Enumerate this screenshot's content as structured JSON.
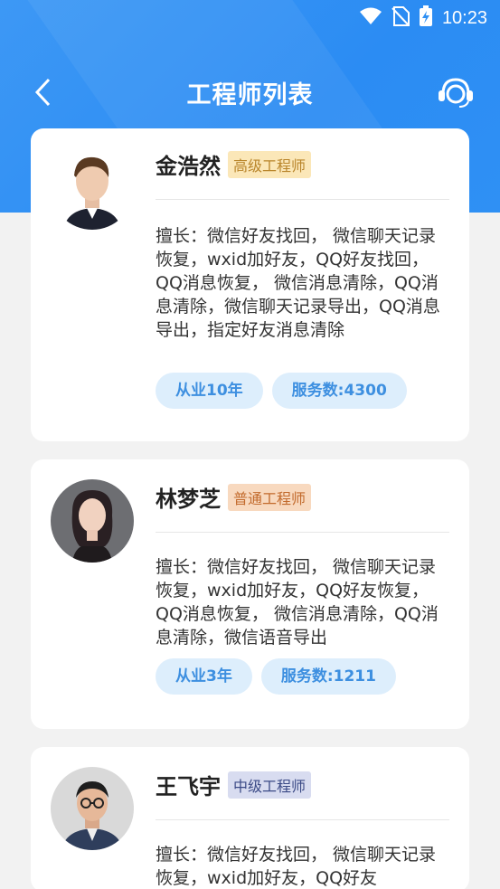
{
  "status": {
    "time": "10:23"
  },
  "header": {
    "title": "工程师列表"
  },
  "engineers": [
    {
      "name": "金浩然",
      "level": "高级工程师",
      "specialty": "擅长：微信好友找回， 微信聊天记录恢复，wxid加好友，QQ好友找回，QQ消息恢复， 微信消息清除，QQ消息清除，微信聊天记录导出，QQ消息导出，指定好友消息清除",
      "years": "从业10年",
      "services": "服务数:4300"
    },
    {
      "name": "林梦芝",
      "level": "普通工程师",
      "specialty": "擅长：微信好友找回， 微信聊天记录恢复，wxid加好友，QQ好友恢复，QQ消息恢复， 微信消息清除，QQ消息清除，微信语音导出",
      "years": "从业3年",
      "services": "服务数:1211"
    },
    {
      "name": "王飞宇",
      "level": "中级工程师",
      "specialty": "擅长：微信好友找回， 微信聊天记录恢复，wxid加好友，QQ好友",
      "years": "",
      "services": ""
    }
  ]
}
